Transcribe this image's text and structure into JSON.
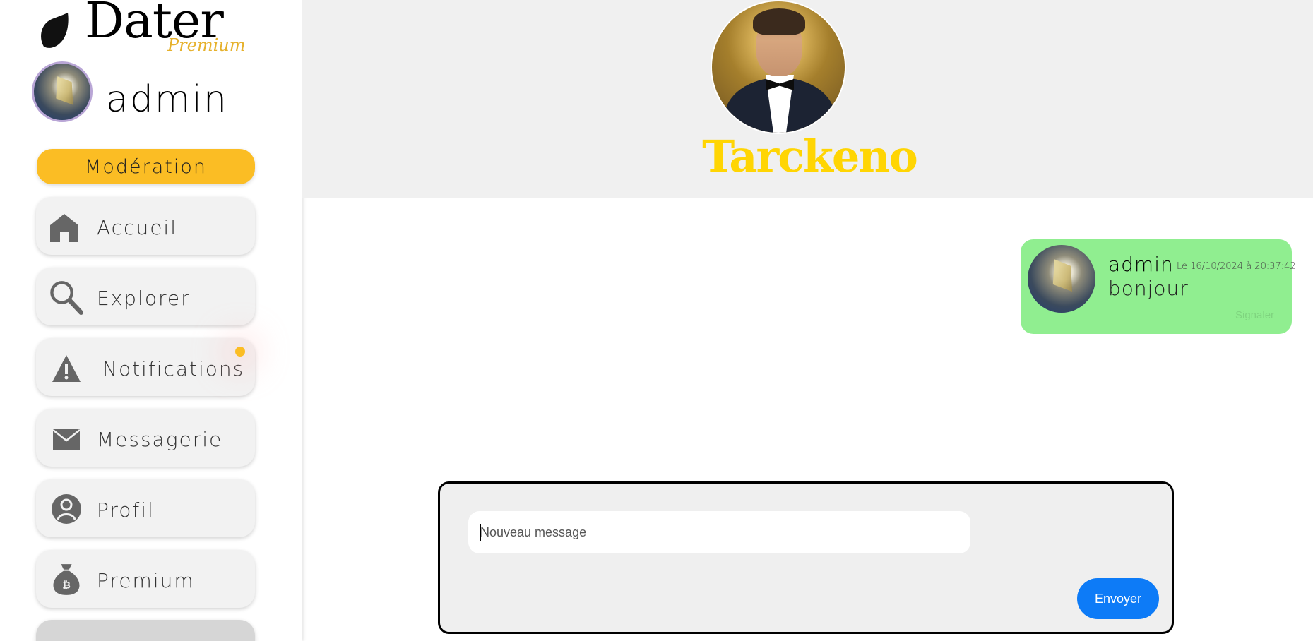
{
  "sidebar": {
    "logo": {
      "text": "Dater",
      "sub": "Premium"
    },
    "user": {
      "name": "admin"
    },
    "moderation_label": "Modération",
    "items": [
      {
        "label": "Accueil",
        "icon": "home-icon"
      },
      {
        "label": "Explorer",
        "icon": "search-icon"
      },
      {
        "label": "Notifications",
        "icon": "warning-icon",
        "has_unread": true
      },
      {
        "label": "Messagerie",
        "icon": "mail-icon"
      },
      {
        "label": "Profil",
        "icon": "user-icon"
      },
      {
        "label": "Premium",
        "icon": "money-bag-icon"
      }
    ]
  },
  "conversation": {
    "contact_name": "Tarckeno",
    "messages": [
      {
        "author": "admin",
        "date": "Le 16/10/2024 à 20:37:42",
        "text": "bonjour",
        "report_label": "Signaler"
      }
    ]
  },
  "composer": {
    "placeholder": "Nouveau message",
    "send_label": "Envoyer"
  },
  "colors": {
    "accent_yellow": "#fbbd24",
    "contact_name": "#ffd503",
    "message_bubble": "#90ee90",
    "send_button": "#0d7bf7"
  }
}
